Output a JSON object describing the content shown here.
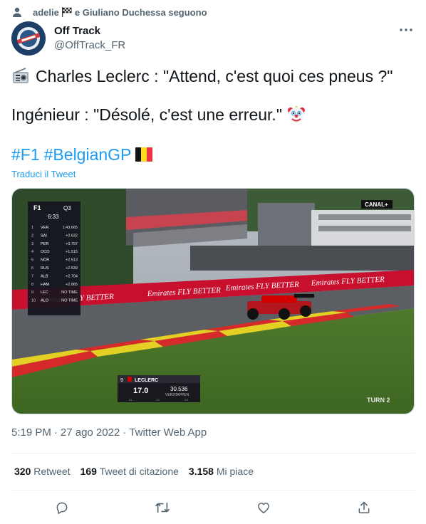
{
  "social_context": {
    "text_before": "adelie",
    "text_after": "e Giuliano Duchessa seguono",
    "icon": "person-icon",
    "flag_icon": "checkered-flag-icon"
  },
  "author": {
    "name": "Off Track",
    "handle": "@OffTrack_FR"
  },
  "tweet": {
    "line1": "Charles Leclerc : \"Attend, c'est quoi ces pneus ?\"",
    "line1_icon": "radio-icon",
    "line2": "Ingénieur : \"Désolé, c'est une erreur.\"",
    "line2_icon": "clown-face-icon",
    "hashtags": [
      "#F1",
      "#BelgianGP"
    ],
    "flag_icon": "belgium-flag-icon",
    "translate_label": "Traduci il Tweet"
  },
  "media": {
    "broadcaster": "CANAL+",
    "leaderboard": {
      "lap": "Q3",
      "clock": "6:33",
      "rows": [
        {
          "pos": "1",
          "driver": "VER",
          "gap": "1:43.665"
        },
        {
          "pos": "2",
          "driver": "SAI",
          "gap": "+0.632"
        },
        {
          "pos": "3",
          "driver": "PER",
          "gap": "+0.797"
        },
        {
          "pos": "4",
          "driver": "OCO",
          "gap": "+1.515"
        },
        {
          "pos": "5",
          "driver": "NOR",
          "gap": "+2.513"
        },
        {
          "pos": "6",
          "driver": "RUS",
          "gap": "+2.539"
        },
        {
          "pos": "7",
          "driver": "ALB",
          "gap": "+2.704"
        },
        {
          "pos": "8",
          "driver": "HAM",
          "gap": "+2.865"
        },
        {
          "pos": "9",
          "driver": "LEC",
          "gap": "NO TIME"
        },
        {
          "pos": "10",
          "driver": "ALO",
          "gap": "NO TIME"
        }
      ]
    },
    "driver_card": {
      "number": "9",
      "name": "LECLERC",
      "speed": "17.0",
      "time": "30.536",
      "compare": "VERSTAPPEN",
      "sectors": [
        "S1",
        "S2",
        "S3"
      ]
    },
    "turn_label": "TURN 2",
    "banner_text": "Emirates FLY BETTER"
  },
  "meta": {
    "time": "5:19 PM",
    "date": "27 ago 2022",
    "separator": "·",
    "source": "Twitter Web App"
  },
  "stats": {
    "retweets_value": "320",
    "retweets_label": "Retweet",
    "quotes_value": "169",
    "quotes_label": "Tweet di citazione",
    "likes_value": "3.158",
    "likes_label": "Mi piace"
  },
  "actions": [
    "reply-icon",
    "retweet-icon",
    "like-icon",
    "share-icon"
  ],
  "colors": {
    "accent": "#1d9bf0",
    "secondary_text": "#536471",
    "ferrari_red": "#d40000",
    "emirates_red": "#c8102e"
  }
}
